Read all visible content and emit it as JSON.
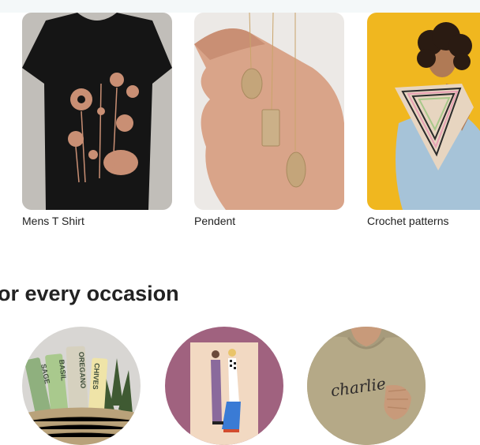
{
  "categories": [
    {
      "label": "Mens T Shirt",
      "image_icon": "tshirt-image"
    },
    {
      "label": "Pendent",
      "image_icon": "necklace-image"
    },
    {
      "label": "Crochet patterns",
      "image_icon": "crochet-image"
    }
  ],
  "section": {
    "title": "or every occasion"
  },
  "occasions": [
    {
      "image_icon": "garden-markers-image",
      "markers": [
        "SAGE",
        "BASIL",
        "OREGANO",
        "CHIVES"
      ]
    },
    {
      "image_icon": "couple-print-image"
    },
    {
      "image_icon": "embroidered-sweatshirt-image",
      "embroidery": "charlie"
    }
  ]
}
